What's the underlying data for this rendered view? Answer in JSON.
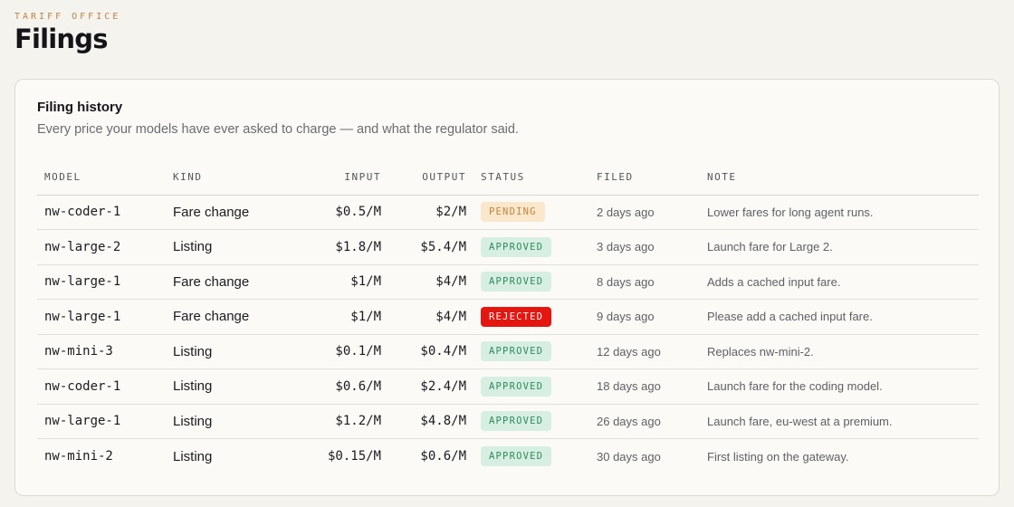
{
  "header": {
    "eyebrow": "TARIFF OFFICE",
    "title": "Filings"
  },
  "card": {
    "title": "Filing history",
    "subtitle": "Every price your models have ever asked to charge — and what the regulator said."
  },
  "table": {
    "columns": {
      "model": "MODEL",
      "kind": "KIND",
      "input": "INPUT",
      "output": "OUTPUT",
      "status": "STATUS",
      "filed": "FILED",
      "note": "NOTE"
    },
    "rows": [
      {
        "model": "nw-coder-1",
        "kind": "Fare change",
        "input": "$0.5/M",
        "output": "$2/M",
        "status": "PENDING",
        "filed": "2 days ago",
        "note": "Lower fares for long agent runs."
      },
      {
        "model": "nw-large-2",
        "kind": "Listing",
        "input": "$1.8/M",
        "output": "$5.4/M",
        "status": "APPROVED",
        "filed": "3 days ago",
        "note": "Launch fare for Large 2."
      },
      {
        "model": "nw-large-1",
        "kind": "Fare change",
        "input": "$1/M",
        "output": "$4/M",
        "status": "APPROVED",
        "filed": "8 days ago",
        "note": "Adds a cached input fare."
      },
      {
        "model": "nw-large-1",
        "kind": "Fare change",
        "input": "$1/M",
        "output": "$4/M",
        "status": "REJECTED",
        "filed": "9 days ago",
        "note": "Please add a cached input fare."
      },
      {
        "model": "nw-mini-3",
        "kind": "Listing",
        "input": "$0.1/M",
        "output": "$0.4/M",
        "status": "APPROVED",
        "filed": "12 days ago",
        "note": "Replaces nw-mini-2."
      },
      {
        "model": "nw-coder-1",
        "kind": "Listing",
        "input": "$0.6/M",
        "output": "$2.4/M",
        "status": "APPROVED",
        "filed": "18 days ago",
        "note": "Launch fare for the coding model."
      },
      {
        "model": "nw-large-1",
        "kind": "Listing",
        "input": "$1.2/M",
        "output": "$4.8/M",
        "status": "APPROVED",
        "filed": "26 days ago",
        "note": "Launch fare, eu-west at a premium."
      },
      {
        "model": "nw-mini-2",
        "kind": "Listing",
        "input": "$0.15/M",
        "output": "$0.6/M",
        "status": "APPROVED",
        "filed": "30 days ago",
        "note": "First listing on the gateway."
      }
    ]
  },
  "colors": {
    "accent": "#c2824a",
    "pending_bg": "#fbe8cc",
    "pending_fg": "#c2843c",
    "approved_bg": "#d7efe3",
    "approved_fg": "#2f8a5c",
    "rejected_bg": "#e5160f",
    "rejected_fg": "#ffffff"
  }
}
